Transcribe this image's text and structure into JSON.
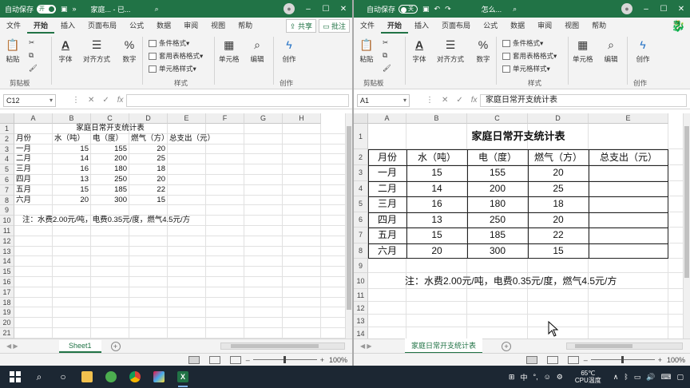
{
  "left": {
    "title": {
      "autosave": "自动保存",
      "toggle": "开",
      "filename": "家庭... - 已...",
      "more": "»"
    },
    "tabs": [
      "文件",
      "开始",
      "插入",
      "页面布局",
      "公式",
      "数据",
      "审阅",
      "视图",
      "帮助"
    ],
    "share": "共享",
    "comment": "批注",
    "ribbon": {
      "paste": "粘贴",
      "font": "字体",
      "align": "对齐方式",
      "number": "数字",
      "cond": "条件格式",
      "table": "套用表格格式",
      "cellstyle": "单元格样式",
      "cells": "单元格",
      "edit": "编辑",
      "create": "创作",
      "g_clip": "剪贴板",
      "g_style": "样式",
      "g_create": "创作"
    },
    "namebox": "C12",
    "formula": "",
    "columns": [
      "A",
      "B",
      "C",
      "D",
      "E",
      "F",
      "G",
      "H"
    ],
    "rows": [
      "1",
      "2",
      "3",
      "4",
      "5",
      "6",
      "7",
      "8",
      "9",
      "10",
      "11",
      "12",
      "13",
      "14",
      "15",
      "16",
      "17",
      "18",
      "19",
      "20",
      "21"
    ],
    "sheet_tab": "Sheet1",
    "zoom": "100%"
  },
  "right": {
    "title": {
      "autosave": "自动保存",
      "toggle": "关",
      "filename": "怎么..."
    },
    "tabs": [
      "文件",
      "开始",
      "插入",
      "页面布局",
      "公式",
      "数据",
      "审阅",
      "视图",
      "帮助"
    ],
    "ribbon": {
      "paste": "粘贴",
      "font": "字体",
      "align": "对齐方式",
      "number": "数字",
      "cond": "条件格式",
      "table": "套用表格格式",
      "cellstyle": "单元格样式",
      "cells": "单元格",
      "edit": "编辑",
      "create": "创作",
      "g_clip": "剪贴板",
      "g_style": "样式",
      "g_create": "创作"
    },
    "namebox": "A1",
    "formula": "家庭日常开支统计表",
    "columns": [
      "A",
      "B",
      "C",
      "D",
      "E"
    ],
    "rows": [
      "1",
      "2",
      "3",
      "4",
      "5",
      "6",
      "7",
      "8",
      "9",
      "10",
      "11",
      "12",
      "13",
      "14"
    ],
    "sheet_tab": "家庭日常开支统计表",
    "zoom": "100%"
  },
  "table": {
    "title": "家庭日常开支统计表",
    "headers": [
      "月份",
      "水（吨）",
      "电（度）",
      "燃气（方）",
      "总支出（元）"
    ],
    "rows": [
      [
        "一月",
        "15",
        "155",
        "20"
      ],
      [
        "二月",
        "14",
        "200",
        "25"
      ],
      [
        "三月",
        "16",
        "180",
        "18"
      ],
      [
        "四月",
        "13",
        "250",
        "20"
      ],
      [
        "五月",
        "15",
        "185",
        "22"
      ],
      [
        "六月",
        "20",
        "300",
        "15"
      ]
    ],
    "note": "注：水费2.00元/吨，电费0.35元/度，燃气4.5元/方"
  },
  "taskbar": {
    "weather_temp": "65℃",
    "weather_label": "CPU温度",
    "ime": "中",
    "punct": "°,"
  },
  "colors": {
    "excel_green": "#217346",
    "taskbar": "#1c2733"
  }
}
